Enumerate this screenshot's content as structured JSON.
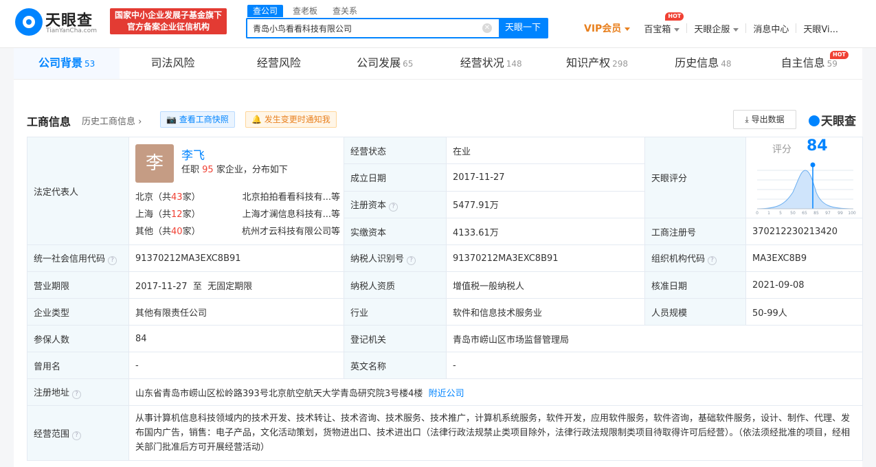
{
  "header": {
    "logo_name": "天眼查",
    "logo_sub": "TianYanCha.com",
    "slogan_line1": "国家中小企业发展子基金旗下",
    "slogan_line2": "官方备案企业征信机构",
    "search_tabs": [
      "查公司",
      "查老板",
      "查关系"
    ],
    "search_value": "青岛小鸟看看科技有限公司",
    "search_button": "天眼一下",
    "nav": {
      "vip": "VIP会员",
      "tools": "百宝箱",
      "hot": "HOT",
      "enterprise": "天眼企服",
      "messages": "消息中心",
      "user": "天眼Vi..."
    }
  },
  "tabs": [
    {
      "label": "公司背景",
      "count": "53"
    },
    {
      "label": "司法风险",
      "count": ""
    },
    {
      "label": "经营风险",
      "count": ""
    },
    {
      "label": "公司发展",
      "count": "65"
    },
    {
      "label": "经营状况",
      "count": "148"
    },
    {
      "label": "知识产权",
      "count": "298"
    },
    {
      "label": "历史信息",
      "count": "48"
    },
    {
      "label": "自主信息",
      "count": "59",
      "badge": "HOT"
    }
  ],
  "section": {
    "title": "工商信息",
    "history_link": "历史工商信息",
    "snapshot_button": "查看工商快照",
    "notify_button": "发生变更时通知我",
    "export_button": "导出数据",
    "brand": "天眼查"
  },
  "rep": {
    "label": "法定代表人",
    "avatar_char": "李",
    "name": "李飞",
    "summary_pre": "任职",
    "summary_count": "95",
    "summary_post": "家企业，分布如下",
    "rows": [
      {
        "region": "北京（共",
        "count": "43",
        "unit": "家）",
        "company": "北京拍拍看看科技有...",
        "suffix": "等"
      },
      {
        "region": "上海（共",
        "count": "12",
        "unit": "家）",
        "company": "上海才澜信息科技有...",
        "suffix": "等"
      },
      {
        "region": "其他（共",
        "count": "40",
        "unit": "家）",
        "company": "杭州才云科技有限公司",
        "suffix": "等"
      }
    ]
  },
  "fields": {
    "status_label": "经营状态",
    "status": "在业",
    "founded_label": "成立日期",
    "founded": "2017-11-27",
    "reg_capital_label": "注册资本",
    "reg_capital": "5477.91万",
    "paid_capital_label": "实缴资本",
    "paid_capital": "4133.61万",
    "score_label": "天眼评分",
    "reg_no_label": "工商注册号",
    "reg_no": "370212230213420",
    "credit_code_label": "统一社会信用代码",
    "credit_code": "91370212MA3EXC8B91",
    "taxpayer_id_label": "纳税人识别号",
    "taxpayer_id": "91370212MA3EXC8B91",
    "org_code_label": "组织机构代码",
    "org_code": "MA3EXC8B9",
    "term_label": "营业期限",
    "term": "2017-11-27  至  无固定期限",
    "tax_quality_label": "纳税人资质",
    "tax_quality": "增值税一般纳税人",
    "approval_label": "核准日期",
    "approval": "2021-09-08",
    "type_label": "企业类型",
    "type": "其他有限责任公司",
    "industry_label": "行业",
    "industry": "软件和信息技术服务业",
    "staff_label": "人员规模",
    "staff": "50-99人",
    "insured_label": "参保人数",
    "insured": "84",
    "authority_label": "登记机关",
    "authority": "青岛市崂山区市场监督管理局",
    "former_name_label": "曾用名",
    "former_name": "-",
    "english_name_label": "英文名称",
    "english_name": "-",
    "address_label": "注册地址",
    "address": "山东省青岛市崂山区松岭路393号北京航空航天大学青岛研究院3号楼4楼",
    "nearby": "附近公司",
    "scope_label": "经营范围",
    "scope": "从事计算机信息科技领域内的技术开发、技术转让、技术咨询、技术服务、技术推广，计算机系统服务，软件开发，应用软件服务，软件咨询，基础软件服务，设计、制作、代理、发布国内广告，销售：电子产品，文化活动策划，货物进出口、技术进出口（法律行政法规禁止类项目除外，法律行政法规限制类项目待取得许可后经营）。（依法须经批准的项目，经相关部门批准后方可开展经营活动）"
  },
  "score": {
    "label": "评分",
    "value": "84",
    "ticks": [
      "0",
      "1",
      "5",
      "50",
      "65",
      "85",
      "97",
      "99",
      "100"
    ],
    "colors": {
      "accent": "#0084ff",
      "curve_fill": "#cfe4fb"
    }
  }
}
